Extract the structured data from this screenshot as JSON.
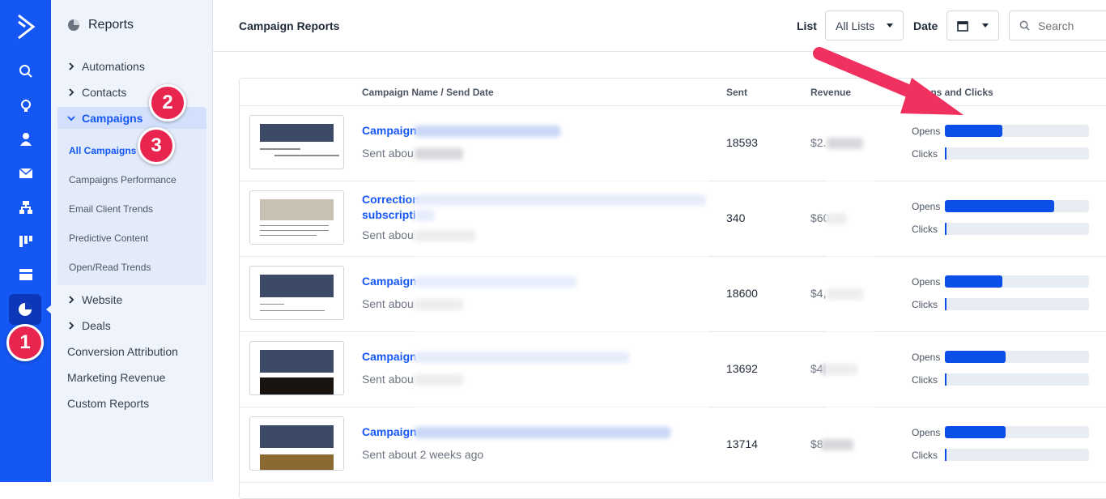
{
  "sidebar": {
    "rail_icons": [
      "logo-icon",
      "search-icon",
      "lightbulb-icon",
      "contacts-icon",
      "email-icon",
      "automations-icon",
      "pipeline-icon",
      "forms-icon",
      "reports-icon"
    ],
    "title": "Reports",
    "items": [
      {
        "label": "Automations",
        "expandable": true
      },
      {
        "label": "Contacts",
        "expandable": true
      },
      {
        "label": "Campaigns",
        "expanded": true
      }
    ],
    "campaign_sub": [
      {
        "label": "All Campaigns",
        "active": true
      },
      {
        "label": "Campaigns Performance"
      },
      {
        "label": "Email Client Trends"
      },
      {
        "label": "Predictive Content"
      },
      {
        "label": "Open/Read Trends"
      }
    ],
    "lower_items": [
      {
        "label": "Website",
        "expandable": true
      },
      {
        "label": "Deals",
        "expandable": true
      },
      {
        "label": "Conversion Attribution"
      },
      {
        "label": "Marketing Revenue"
      },
      {
        "label": "Custom Reports"
      }
    ]
  },
  "annotations": {
    "badge1": "1",
    "badge2": "2",
    "badge3": "3"
  },
  "header": {
    "title": "Campaign Reports",
    "list_label": "List",
    "list_value": "All Lists",
    "date_label": "Date",
    "search_placeholder": "Search"
  },
  "table": {
    "columns": [
      "Campaign Name / Send Date",
      "Sent",
      "Revenue",
      "Opens and Clicks"
    ],
    "opens_label": "Opens",
    "clicks_label": "Clicks",
    "rows": [
      {
        "name": "Campaign",
        "name2": "",
        "sub": "Sent abou",
        "sent": "18593",
        "revenue": "$2.",
        "opens": 0.4,
        "clicks": 0.01
      },
      {
        "name": "Correction",
        "name2": "subscripti",
        "sub": "Sent abou",
        "sent": "340",
        "revenue": "$60",
        "opens": 0.76,
        "clicks": 0.01
      },
      {
        "name": "Campaign",
        "name2": "",
        "sub": "Sent abou",
        "sent": "18600",
        "revenue": "$4,",
        "opens": 0.4,
        "clicks": 0.01
      },
      {
        "name": "Campaign",
        "name2": "",
        "sub": "Sent abou",
        "sent": "13692",
        "revenue": "$4",
        "opens": 0.42,
        "clicks": 0.01
      },
      {
        "name": "Campaign",
        "name2": "",
        "sub": "Sent about 2 weeks ago",
        "sent": "13714",
        "revenue": "$8",
        "opens": 0.42,
        "clicks": 0.01
      }
    ]
  },
  "colors": {
    "brand": "#1557f5",
    "badge": "#e8254e",
    "bar": "#0b4ee8"
  }
}
